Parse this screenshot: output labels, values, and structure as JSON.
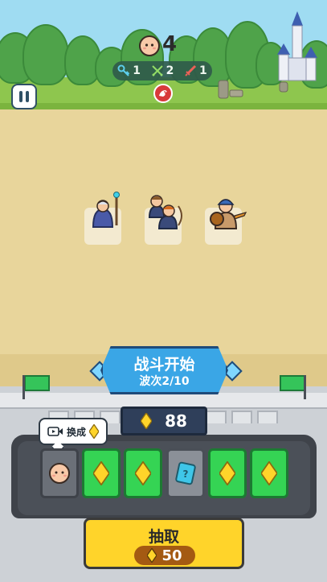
{
  "hud": {
    "lives": "4",
    "stats": [
      {
        "icon": "key-icon",
        "value": "1"
      },
      {
        "icon": "crossed-swords-icon",
        "value": "2"
      },
      {
        "icon": "sword-icon",
        "value": "1"
      }
    ],
    "boss_icon": "dragon-boss-icon",
    "pause_icon": "pause-icon"
  },
  "banner": {
    "title": "战斗开始",
    "wave": "波次2/10"
  },
  "gold": {
    "value": "88",
    "icon": "diamond-gem-icon"
  },
  "swap": {
    "label": "换成",
    "icon": "video-icon"
  },
  "cards": [
    {
      "type": "face",
      "icon": "smiley-face-icon"
    },
    {
      "type": "gem",
      "icon": "diamond-gem-icon"
    },
    {
      "type": "gem",
      "icon": "diamond-gem-icon"
    },
    {
      "type": "mystery",
      "icon": "mystery-card-icon"
    },
    {
      "type": "gem",
      "icon": "diamond-gem-icon"
    },
    {
      "type": "gem",
      "icon": "diamond-gem-icon"
    }
  ],
  "draw": {
    "label": "抽取",
    "cost": "50"
  },
  "colors": {
    "accent_blue": "#3aa6e6",
    "gem_yellow": "#ffd42a",
    "card_green": "#35d454",
    "sand": "#e8d59b"
  }
}
